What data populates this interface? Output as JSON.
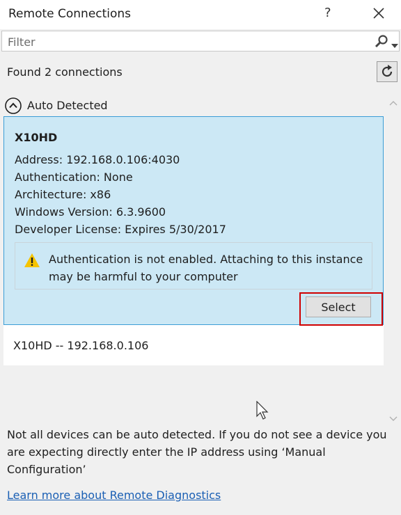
{
  "window": {
    "title": "Remote Connections",
    "help_label": "?"
  },
  "filter": {
    "placeholder": "Filter",
    "value": ""
  },
  "status": {
    "found_text": "Found 2 connections"
  },
  "group": {
    "label": "Auto Detected"
  },
  "selected_connection": {
    "name": "X10HD",
    "details": [
      "Address: 192.168.0.106:4030",
      "Authentication: None",
      "Architecture: x86",
      "Windows Version: 6.3.9600",
      "Developer License: Expires 5/30/2017"
    ],
    "warning": "Authentication is not enabled. Attaching to this instance may be harmful to your computer",
    "select_label": "Select"
  },
  "other_connection": {
    "label": "X10HD -- 192.168.0.106"
  },
  "footer": {
    "info": "Not all devices can be auto detected. If you do not see a device you are expecting directly enter the IP address using ‘Manual Configuration’",
    "link": "Learn more about Remote Diagnostics"
  },
  "colors": {
    "selection_bg": "#cce8f5",
    "selection_border": "#3b9dd6",
    "highlight": "#d00000",
    "link": "#1a5fb4",
    "warning": "#f5c400"
  }
}
